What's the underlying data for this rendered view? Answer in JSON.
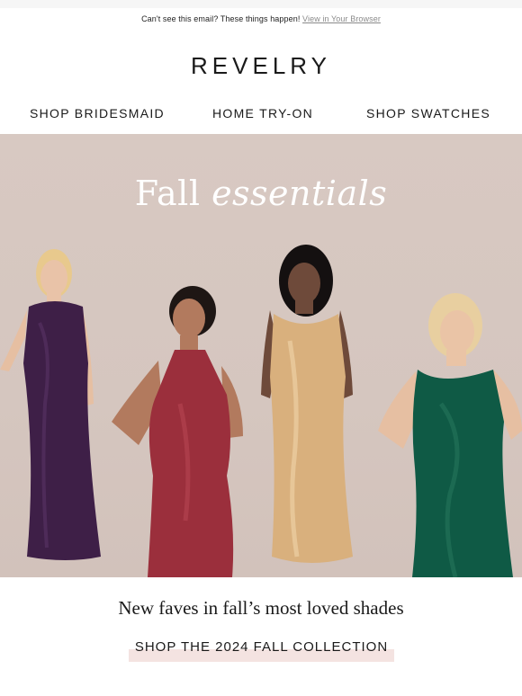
{
  "preheader": {
    "text": "Can't see this email? These things happen!",
    "link_label": "View in Your Browser"
  },
  "brand": {
    "logo": "REVELRY"
  },
  "nav": {
    "items": [
      {
        "label": "SHOP BRIDESMAID"
      },
      {
        "label": "HOME TRY-ON"
      },
      {
        "label": "SHOP SWATCHES"
      }
    ]
  },
  "hero": {
    "title_plain": "Fall ",
    "title_italic": "essentials",
    "dress_colors": {
      "plum": "#3e1f47",
      "rose": "#9b2f3c",
      "champagne": "#d9b07d",
      "emerald": "#0f5a45"
    }
  },
  "main": {
    "subheading": "New faves in fall’s most loved shades",
    "cta_label": "SHOP THE 2024 FALL COLLECTION"
  },
  "colors": {
    "hero_background": "#d6c7c0",
    "cta_highlight": "#f4e3e1",
    "text": "#1a1a1a"
  }
}
